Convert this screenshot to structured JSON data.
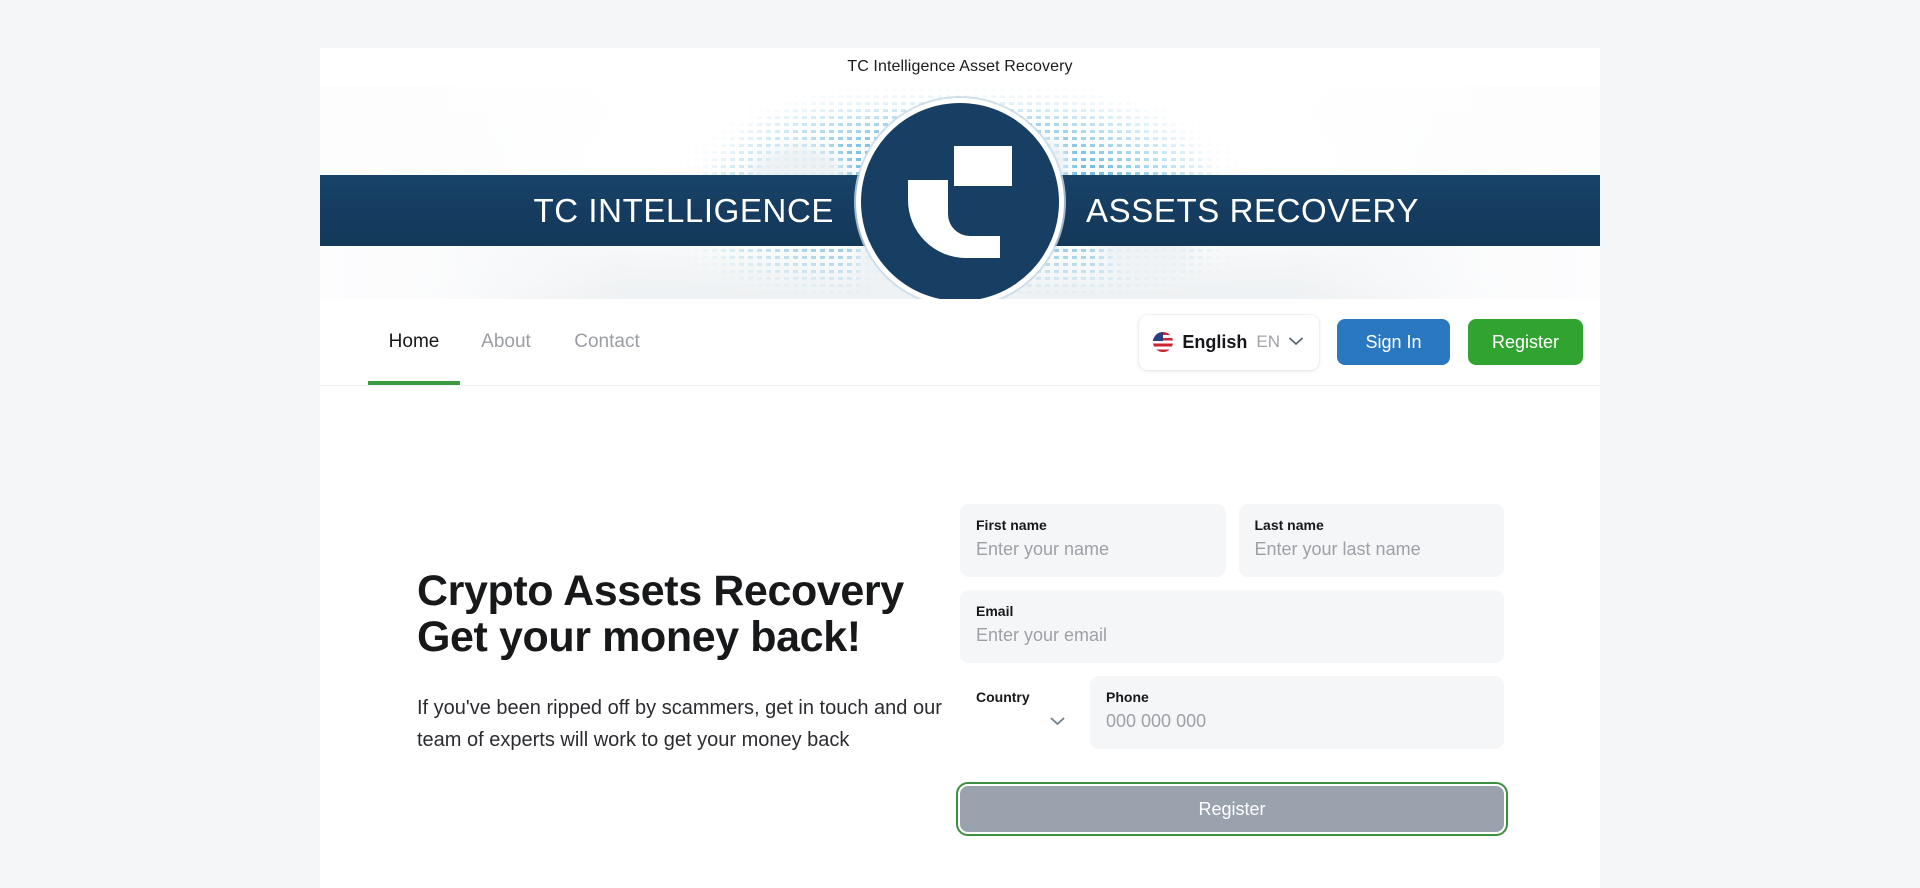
{
  "window": {
    "title": "TC Intelligence Asset Recovery"
  },
  "banner": {
    "left_word": "TC INTELLIGENCE",
    "right_word": "ASSETS RECOVERY",
    "logo_icon": "tc-logo-icon",
    "bar_color": "#153c5f",
    "logo_circle_color": "#173f63"
  },
  "nav": {
    "tabs": [
      {
        "label": "Home",
        "active": true
      },
      {
        "label": "About",
        "active": false
      },
      {
        "label": "Contact",
        "active": false
      }
    ],
    "active_underline_color": "#3b9c3f",
    "language": {
      "flag_icon": "us-flag-icon",
      "name": "English",
      "code": "EN",
      "chevron_icon": "chevron-down-icon"
    },
    "sign_in_label": "Sign In",
    "register_label": "Register",
    "sign_in_color": "#2a78c0",
    "register_color": "#31a331"
  },
  "hero": {
    "title": "Crypto Assets Recovery Get your money back!",
    "subtitle": "If you've been ripped off by scammers, get in touch and our team of experts will work to get your money back"
  },
  "form": {
    "first_name": {
      "label": "First name",
      "value": "",
      "placeholder": "Enter your name"
    },
    "last_name": {
      "label": "Last name",
      "value": "",
      "placeholder": "Enter your last name"
    },
    "email": {
      "label": "Email",
      "value": "",
      "placeholder": "Enter your email"
    },
    "country": {
      "label": "Country",
      "value": "",
      "chevron_icon": "chevron-down-icon"
    },
    "phone": {
      "label": "Phone",
      "value": "",
      "placeholder": "000 000 000"
    },
    "submit_label": "Register",
    "submit_disabled_color": "#9aa2ad",
    "submit_focus_ring_color": "#3b8f3f"
  }
}
